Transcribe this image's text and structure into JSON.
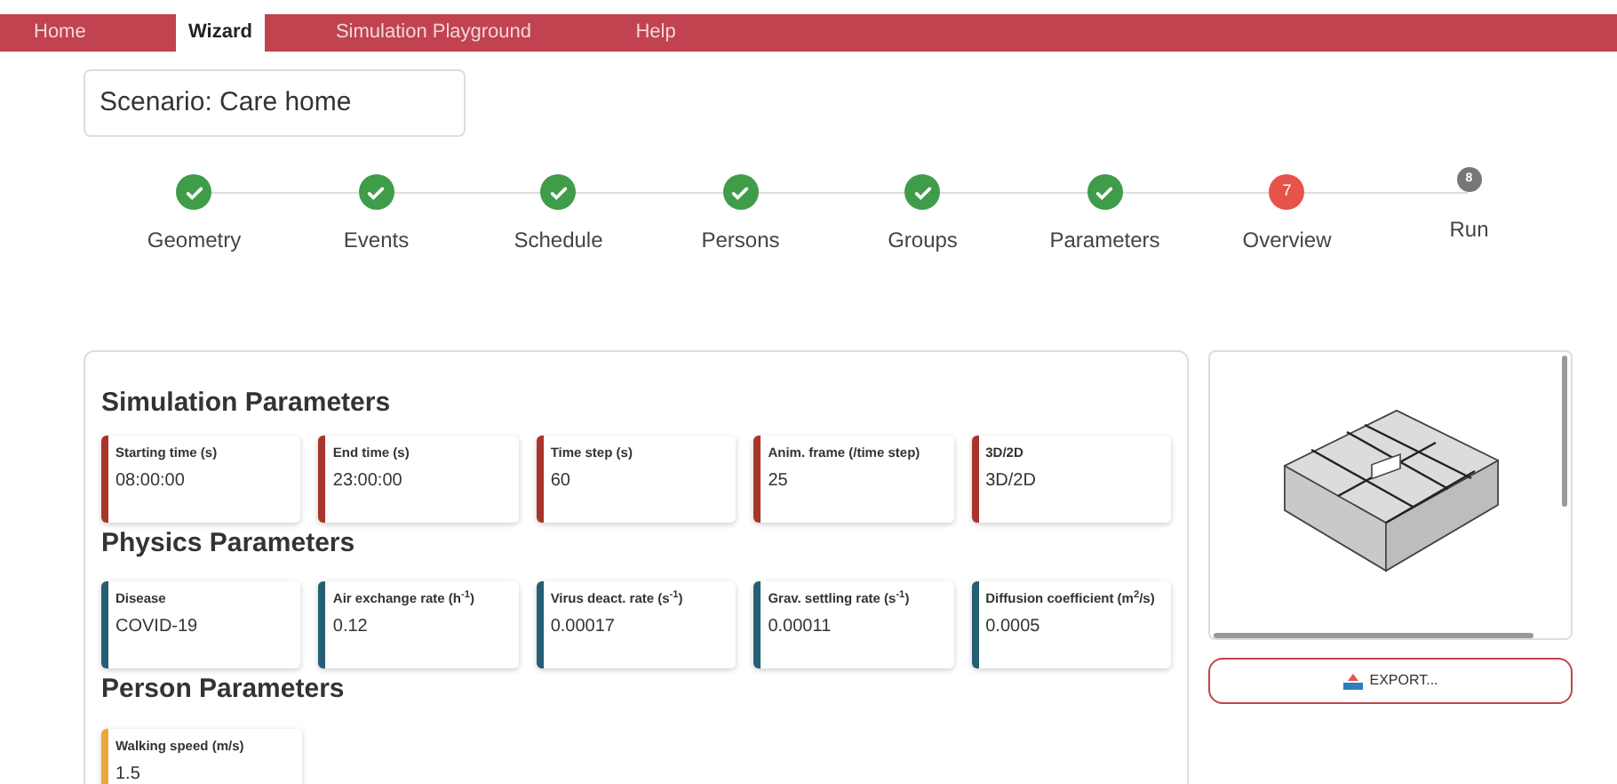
{
  "nav": [
    {
      "label": "Home",
      "selected": false
    },
    {
      "label": "Wizard",
      "selected": true
    },
    {
      "label": "Simulation Playground",
      "selected": false
    },
    {
      "label": "Help",
      "selected": false
    }
  ],
  "scenario": {
    "title": "Scenario: Care home"
  },
  "steps": [
    {
      "label": "Geometry",
      "kind": "done"
    },
    {
      "label": "Events",
      "kind": "done"
    },
    {
      "label": "Schedule",
      "kind": "done"
    },
    {
      "label": "Persons",
      "kind": "done"
    },
    {
      "label": "Groups",
      "kind": "done"
    },
    {
      "label": "Parameters",
      "kind": "done"
    },
    {
      "label": "Overview",
      "kind": "current",
      "number": "7"
    },
    {
      "label": "Run",
      "kind": "pending",
      "number": "8"
    }
  ],
  "sections": [
    {
      "title": "Simulation Parameters",
      "color": "#a8352b",
      "fields": [
        {
          "label": "Starting time (s)",
          "value": "08:00:00"
        },
        {
          "label": "End time (s)",
          "value": "23:00:00"
        },
        {
          "label": "Time step (s)",
          "value": "60"
        },
        {
          "label": "Anim. frame (/time step)",
          "value": "25"
        },
        {
          "label": "3D/2D",
          "value": "3D/2D"
        }
      ]
    },
    {
      "title": "Physics Parameters",
      "color": "#245f73",
      "fields": [
        {
          "label": "Disease",
          "value": "COVID-19"
        },
        {
          "label": "Air exchange rate (h$^{-1}$)",
          "value": "0.12"
        },
        {
          "label": "Virus deact. rate (s$^{-1}$)",
          "value": "0.00017"
        },
        {
          "label": "Grav. settling rate (s$^{-1}$)",
          "value": "0.00011"
        },
        {
          "label": "Diffusion coefficient (m$^{2}$/s)",
          "value": "0.0005"
        }
      ]
    },
    {
      "title": "Person Parameters",
      "color": "#e8a93a",
      "fields": [
        {
          "label": "Walking speed (m/s)",
          "value": "1.5"
        }
      ]
    }
  ],
  "export_button": {
    "label": "EXPORT..."
  }
}
